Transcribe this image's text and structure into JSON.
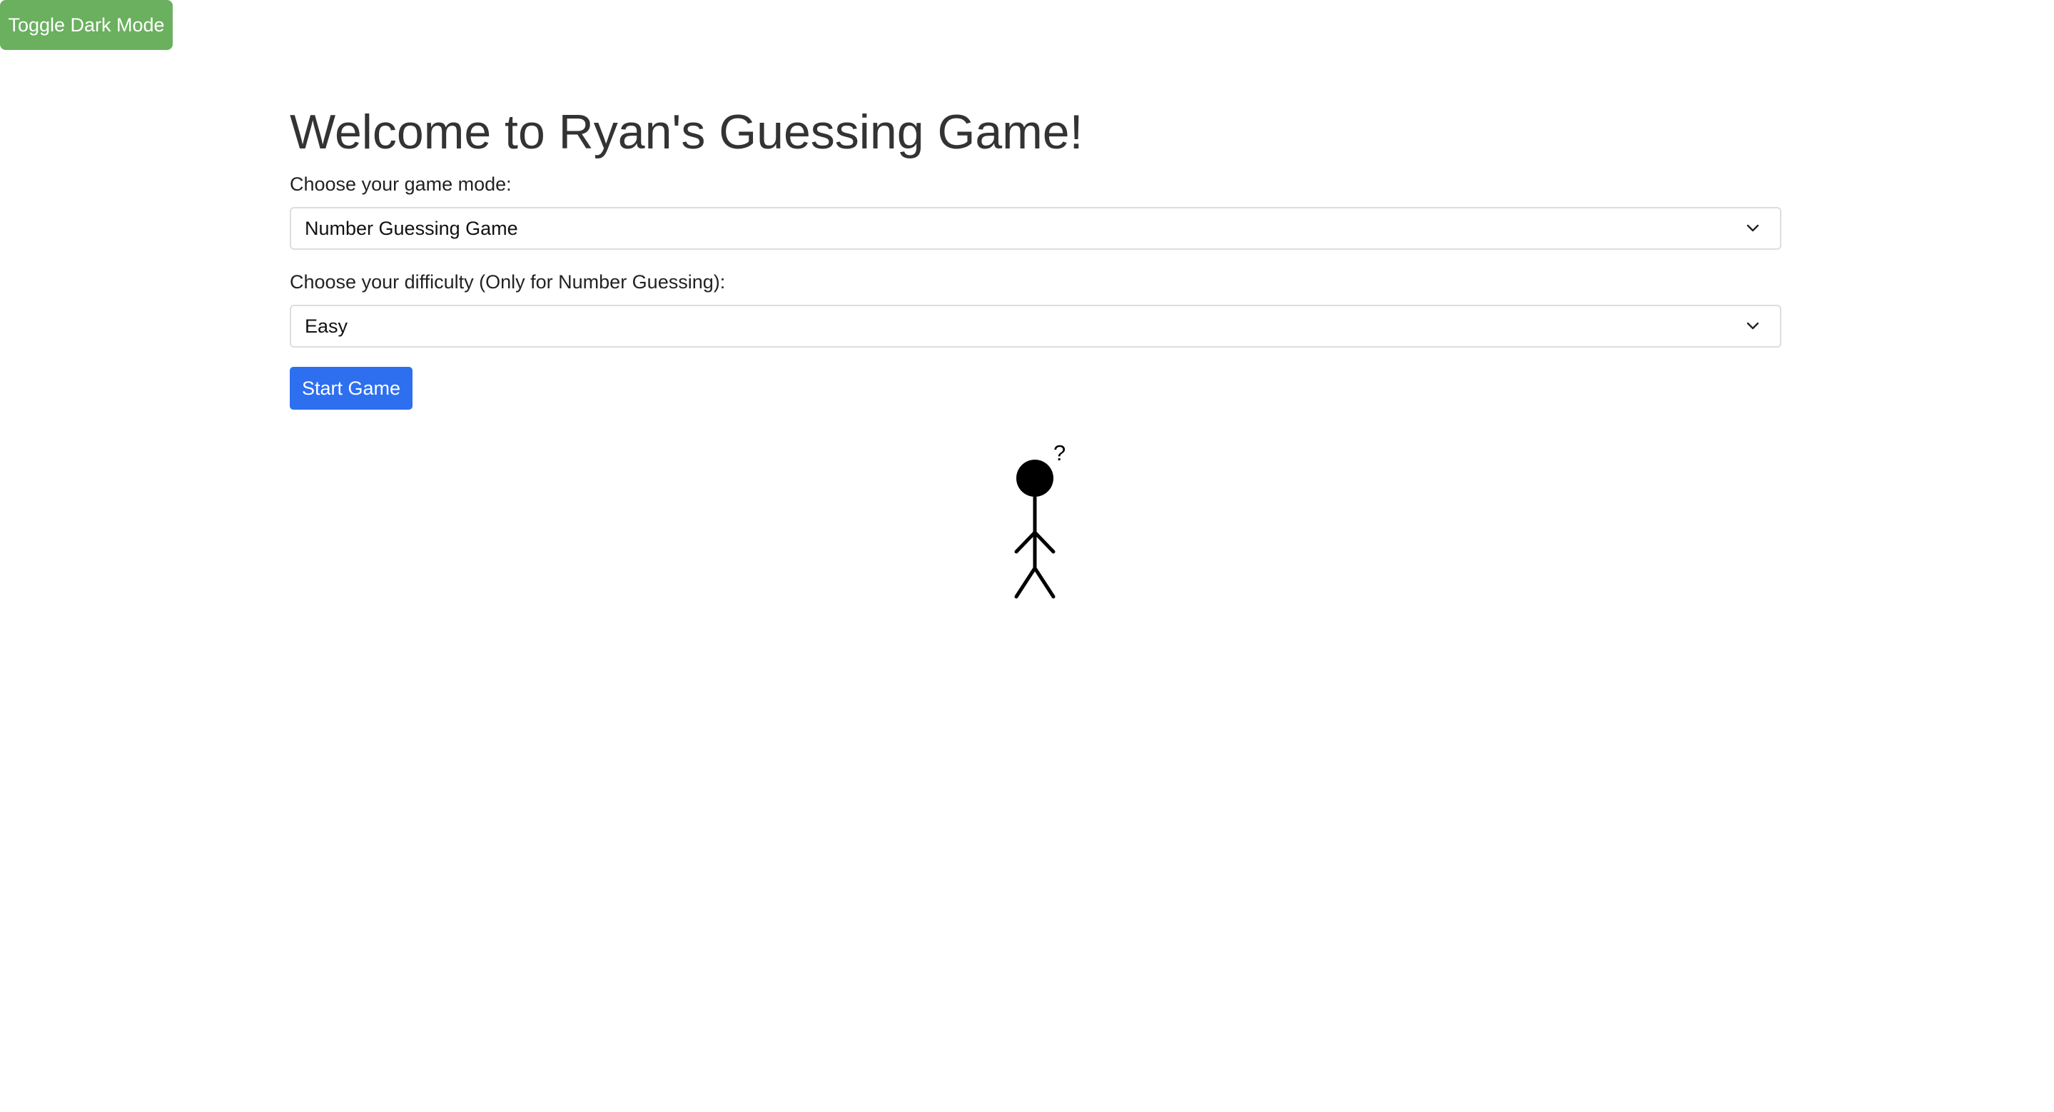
{
  "toggle": {
    "label": "Toggle Dark Mode",
    "color": "#6ab05f"
  },
  "header": {
    "title": "Welcome to Ryan's Guessing Game!"
  },
  "game_mode": {
    "label": "Choose your game mode:",
    "selected": "Number Guessing Game"
  },
  "difficulty": {
    "label": "Choose your difficulty (Only for Number Guessing):",
    "selected": "Easy"
  },
  "start": {
    "label": "Start Game",
    "color": "#2e6ff0"
  },
  "figure": {
    "thought": "?"
  },
  "icons": {
    "select_arrow": "chevron-down-icon",
    "figure": "stick-figure-icon"
  }
}
